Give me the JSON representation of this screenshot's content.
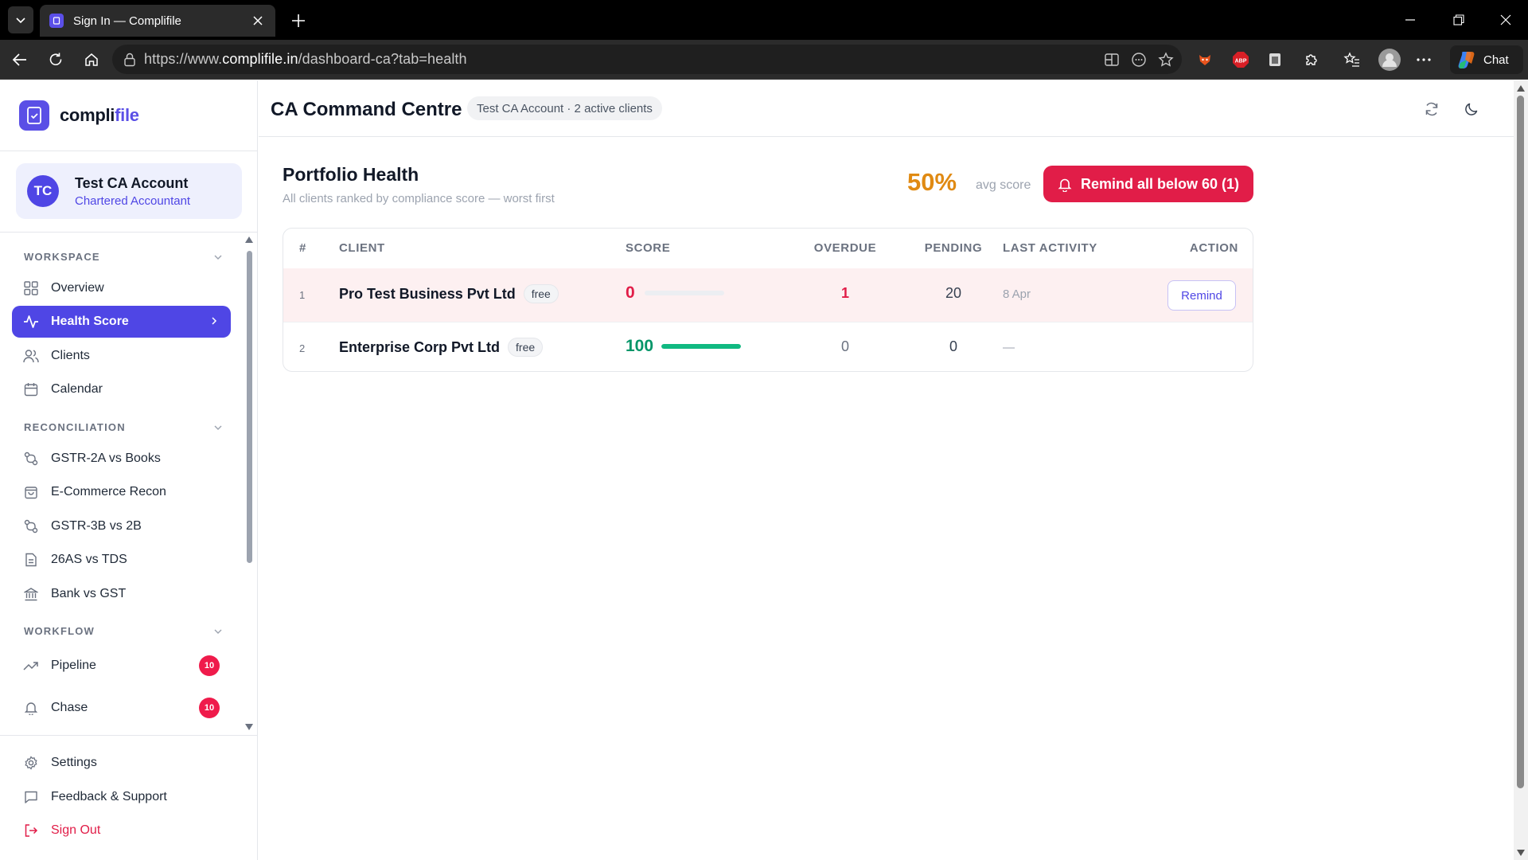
{
  "browser": {
    "tab_title": "Sign In — Complifile",
    "url_prefix": "https://www.",
    "url_domain": "complifile.in",
    "url_path": "/dashboard-ca?tab=health",
    "chat_label": "Chat",
    "abp_label": "ABP"
  },
  "sidebar": {
    "brand_a": "compli",
    "brand_b": "file",
    "user": {
      "initials": "TC",
      "name": "Test CA Account",
      "role": "Chartered Accountant"
    },
    "sections": {
      "workspace": "WORKSPACE",
      "reconciliation": "RECONCILIATION",
      "workflow": "WORKFLOW"
    },
    "items": {
      "overview": "Overview",
      "health": "Health Score",
      "clients": "Clients",
      "calendar": "Calendar",
      "gstr2a": "GSTR-2A vs Books",
      "ecom": "E-Commerce Recon",
      "gstr3b": "GSTR-3B vs 2B",
      "as26": "26AS vs TDS",
      "bank": "Bank vs GST",
      "pipeline": "Pipeline",
      "pipeline_badge": "10",
      "chase": "Chase",
      "chase_badge": "10",
      "settings": "Settings",
      "feedback": "Feedback & Support",
      "signout": "Sign Out"
    }
  },
  "header": {
    "title": "CA Command Centre",
    "context": "Test CA Account · 2 active clients"
  },
  "portfolio": {
    "title": "Portfolio Health",
    "subtitle": "All clients ranked by compliance score — worst first",
    "avg_score": "50%",
    "avg_label": "avg score",
    "remind_all": "Remind all below 60 (1)",
    "columns": {
      "rank": "#",
      "client": "CLIENT",
      "score": "SCORE",
      "overdue": "OVERDUE",
      "pending": "PENDING",
      "last": "LAST ACTIVITY",
      "action": "ACTION"
    },
    "rows": [
      {
        "rank": "1",
        "client": "Pro Test Business Pvt Ltd",
        "plan": "free",
        "score": "0",
        "score_pct": 0,
        "overdue": "1",
        "pending": "20",
        "last": "8 Apr",
        "action": "Remind"
      },
      {
        "rank": "2",
        "client": "Enterprise Corp Pvt Ltd",
        "plan": "free",
        "score": "100",
        "score_pct": 100,
        "overdue": "0",
        "pending": "0",
        "last": "—",
        "action": ""
      }
    ]
  },
  "colors": {
    "accent": "#4f46e5",
    "danger": "#e11d48",
    "warning": "#e08a13",
    "success": "#10b981"
  }
}
